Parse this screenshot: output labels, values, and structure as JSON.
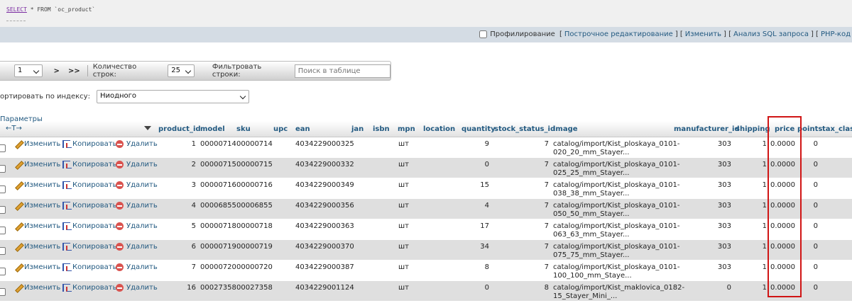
{
  "sql": {
    "keyword": "SELECT",
    "rest": " * FROM `oc_product`"
  },
  "links": {
    "profiling_label": "Профилирование",
    "inline_edit": "Построчное редактирование",
    "edit": "Изменить",
    "explain": "Анализ SQL запроса",
    "php_code": "PHP-код"
  },
  "nav": {
    "page_value": "1",
    "next": ">",
    "last": ">>",
    "rows_label": "Количество строк:",
    "rows_value": "25",
    "filter_label": "Фильтровать строки:",
    "search_placeholder": "Поиск в таблице"
  },
  "sort": {
    "label": "ортировать по индексу:",
    "value": "Ниодного"
  },
  "params": {
    "label": "Параметры",
    "arrows": "←T→"
  },
  "columns": [
    "product_id",
    "model",
    "sku",
    "upc",
    "ean",
    "jan",
    "isbn",
    "mpn",
    "location",
    "quantity",
    "stock_status_id",
    "image",
    "manufacturer_id",
    "shipping",
    "price",
    "points",
    "tax_clas"
  ],
  "actions": {
    "edit": "Изменить",
    "copy": "Копировать",
    "delete": "Удалить"
  },
  "rows": [
    {
      "product_id": "1",
      "model": "00000714",
      "sku": "00000714",
      "ean": "4034229000325",
      "mpn": "шт",
      "quantity": "9",
      "stock_status_id": "7",
      "image1": "catalog/import/Kist_ploskaya_0101-",
      "image2": "020_20_mm_Stayer...",
      "manufacturer_id": "303",
      "shipping": "1",
      "price": "0.0000",
      "points": "0"
    },
    {
      "product_id": "2",
      "model": "00000715",
      "sku": "00000715",
      "ean": "4034229000332",
      "mpn": "шт",
      "quantity": "0",
      "stock_status_id": "7",
      "image1": "catalog/import/Kist_ploskaya_0101-",
      "image2": "025_25_mm_Stayer...",
      "manufacturer_id": "303",
      "shipping": "1",
      "price": "0.0000",
      "points": "0"
    },
    {
      "product_id": "3",
      "model": "00000716",
      "sku": "00000716",
      "ean": "4034229000349",
      "mpn": "шт",
      "quantity": "15",
      "stock_status_id": "7",
      "image1": "catalog/import/Kist_ploskaya_0101-",
      "image2": "038_38_mm_Stayer...",
      "manufacturer_id": "303",
      "shipping": "1",
      "price": "0.0000",
      "points": "0"
    },
    {
      "product_id": "4",
      "model": "00006855",
      "sku": "00006855",
      "ean": "4034229000356",
      "mpn": "шт",
      "quantity": "4",
      "stock_status_id": "7",
      "image1": "catalog/import/Kist_ploskaya_0101-",
      "image2": "050_50_mm_Stayer...",
      "manufacturer_id": "303",
      "shipping": "1",
      "price": "0.0000",
      "points": "0"
    },
    {
      "product_id": "5",
      "model": "00000718",
      "sku": "00000718",
      "ean": "4034229000363",
      "mpn": "шт",
      "quantity": "17",
      "stock_status_id": "7",
      "image1": "catalog/import/Kist_ploskaya_0101-",
      "image2": "063_63_mm_Stayer...",
      "manufacturer_id": "303",
      "shipping": "1",
      "price": "0.0000",
      "points": "0"
    },
    {
      "product_id": "6",
      "model": "00000719",
      "sku": "00000719",
      "ean": "4034229000370",
      "mpn": "шт",
      "quantity": "34",
      "stock_status_id": "7",
      "image1": "catalog/import/Kist_ploskaya_0101-",
      "image2": "075_75_mm_Stayer...",
      "manufacturer_id": "303",
      "shipping": "1",
      "price": "0.0000",
      "points": "0"
    },
    {
      "product_id": "7",
      "model": "00000720",
      "sku": "00000720",
      "ean": "4034229000387",
      "mpn": "шт",
      "quantity": "8",
      "stock_status_id": "7",
      "image1": "catalog/import/Kist_ploskaya_0101-",
      "image2": "100_100_mm_Staye...",
      "manufacturer_id": "303",
      "shipping": "1",
      "price": "0.0000",
      "points": "0"
    },
    {
      "product_id": "16",
      "model": "00027358",
      "sku": "00027358",
      "ean": "4034229001124",
      "mpn": "шт",
      "quantity": "0",
      "stock_status_id": "8",
      "image1": "catalog/import/Kist_maklovica_0182-",
      "image2": "15_Stayer_Mini_...",
      "manufacturer_id": "0",
      "shipping": "1",
      "price": "0.0000",
      "points": "0"
    }
  ],
  "highlight_color": "#d01515"
}
